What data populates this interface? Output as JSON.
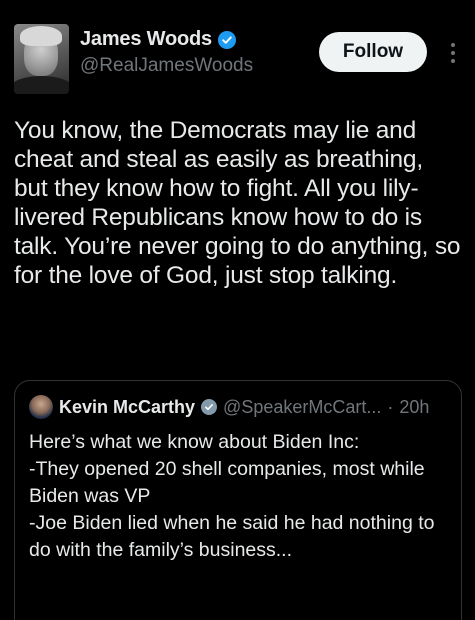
{
  "author": {
    "display_name": "James Woods",
    "handle": "@RealJamesWoods",
    "verified_color": "#1d9bf0"
  },
  "actions": {
    "follow_label": "Follow"
  },
  "tweet": {
    "text": "You know, the Democrats may lie and cheat and steal as easily as breathing, but they know how to fight. All you lily-livered Republicans know how to do is talk. You’re never going to do anything, so for the love of God, just stop talking."
  },
  "quoted_tweet": {
    "display_name": "Kevin McCarthy",
    "handle": "@SpeakerMcCart...",
    "separator": "·",
    "time": "20h",
    "verified_color": "#829aab",
    "text": "Here’s what we know about Biden Inc:\n-They opened 20 shell companies, most while Biden was VP\n-Joe Biden lied when he said he had nothing to do with the family’s business..."
  },
  "colors": {
    "background": "#000000",
    "primary_text": "#e7e9ea",
    "secondary_text": "#71767b",
    "border": "#2f3336",
    "follow_button_bg": "#eff3f4"
  }
}
